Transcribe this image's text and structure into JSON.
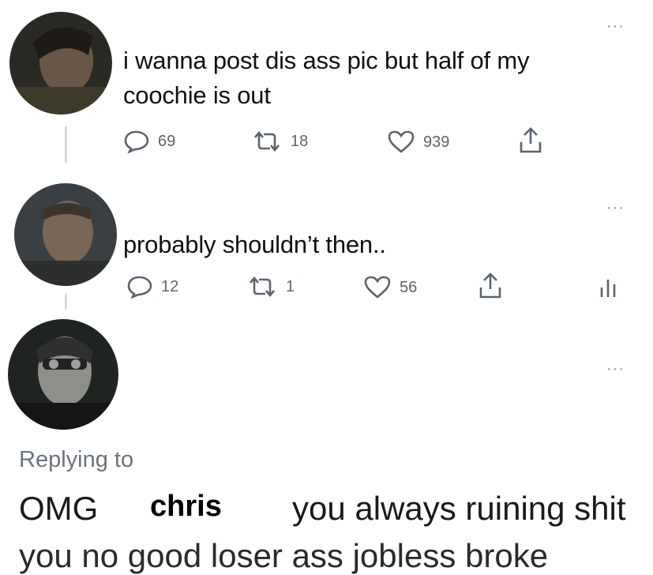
{
  "tweets": [
    {
      "text_line1": "i wanna post dis ass pic but half of my",
      "text_line2": "coochie is out",
      "replies": "69",
      "retweets": "18",
      "likes": "939",
      "more": "···"
    },
    {
      "text": "probably shouldn’t then..",
      "replies": "12",
      "retweets": "1",
      "likes": "56",
      "more": "···"
    },
    {
      "more": "···"
    }
  ],
  "reply": {
    "replying_to": "Replying to",
    "word1": "OMG",
    "name_overlay": "chris",
    "rest": "you always ruining shit",
    "cut_line": "you no good loser ass jobless broke"
  },
  "icons": {
    "reply": "speech-bubble-icon",
    "retweet": "retweet-icon",
    "like": "heart-icon",
    "share": "share-icon",
    "analytics": "analytics-icon",
    "more": "more-icon"
  },
  "colors": {
    "icon_gray": "#5b6470",
    "text": "#111111",
    "muted": "#6b7380",
    "thread_line": "#d5d8dc"
  }
}
